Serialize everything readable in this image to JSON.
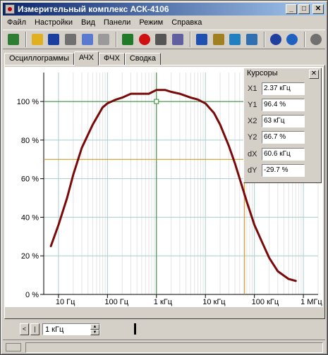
{
  "window": {
    "title": "Измерительный комплекс АСК-4106",
    "minimize_label": "_",
    "maximize_label": "□",
    "close_label": "✕"
  },
  "menu": [
    "Файл",
    "Настройки",
    "Вид",
    "Панели",
    "Режим",
    "Справка"
  ],
  "toolbar": {
    "icons": [
      "exit-icon",
      "open-folder-icon",
      "save-icon",
      "camera-icon",
      "copy-icon",
      "print-icon",
      "run-icon",
      "stop-icon",
      "step-icon",
      "scale-icon",
      "info-panel-icon",
      "cursor-tool-icon",
      "generator-icon",
      "filter-icon",
      "help-icon",
      "info-icon",
      "refresh-icon"
    ],
    "colors": {
      "exit-icon": "#2e7d32",
      "open-folder-icon": "#e0b020",
      "save-icon": "#1a3fa0",
      "camera-icon": "#707070",
      "copy-icon": "#5a7ad0",
      "print-icon": "#9a9a9a",
      "run-icon": "#1f7a2a",
      "stop-icon": "#d01010",
      "step-icon": "#555555",
      "scale-icon": "#6060a0",
      "info-panel-icon": "#2050b0",
      "cursor-tool-icon": "#a08020",
      "generator-icon": "#2080c0",
      "filter-icon": "#3070b0",
      "help-icon": "#2040a0",
      "info-icon": "#2060c0",
      "refresh-icon": "#707070"
    }
  },
  "tabs": [
    {
      "label": "Осциллограммы",
      "active": false
    },
    {
      "label": "АЧХ",
      "active": true
    },
    {
      "label": "ФЧХ",
      "active": false
    },
    {
      "label": "Сводка",
      "active": false
    }
  ],
  "cursors": {
    "title": "Курсоры",
    "close_label": "✕",
    "rows": [
      {
        "label": "X1",
        "value": "2.37 кГц"
      },
      {
        "label": "Y1",
        "value": "96.4 %"
      },
      {
        "label": "X2",
        "value": "63 кГц"
      },
      {
        "label": "Y2",
        "value": "66.7 %"
      },
      {
        "label": "dX",
        "value": "60.6 кГц"
      },
      {
        "label": "dY",
        "value": "-29.7 %"
      }
    ]
  },
  "bottom": {
    "prev_label": "<",
    "next_label": "|",
    "step_value": "1 кГц"
  },
  "chart_data": {
    "type": "line",
    "title": "",
    "xlabel": "",
    "ylabel": "",
    "x_scale": "log",
    "xlim": [
      5,
      2000000
    ],
    "ylim": [
      0,
      115
    ],
    "x_ticks": [
      {
        "value": 10,
        "label": "10 Гц"
      },
      {
        "value": 100,
        "label": "100 Гц"
      },
      {
        "value": 1000,
        "label": "1 кГц"
      },
      {
        "value": 10000,
        "label": "10 кГц"
      },
      {
        "value": 100000,
        "label": "100 кГц"
      },
      {
        "value": 1000000,
        "label": "1 МГц"
      }
    ],
    "y_ticks": [
      {
        "value": 0,
        "label": "0 %"
      },
      {
        "value": 20,
        "label": "20 %"
      },
      {
        "value": 40,
        "label": "40 %"
      },
      {
        "value": 60,
        "label": "60 %"
      },
      {
        "value": 80,
        "label": "80 %"
      },
      {
        "value": 100,
        "label": "100 %"
      }
    ],
    "grid": true,
    "series": [
      {
        "color": "#7a0a0a",
        "x": [
          7,
          10,
          15,
          20,
          30,
          50,
          80,
          100,
          150,
          200,
          300,
          500,
          700,
          1000,
          1500,
          2000,
          3000,
          5000,
          7000,
          10000,
          15000,
          20000,
          30000,
          40000,
          50000,
          70000,
          100000,
          150000,
          200000,
          300000,
          500000,
          700000
        ],
        "y": [
          25,
          36,
          50,
          62,
          76,
          88,
          97,
          99,
          101,
          102,
          104,
          104,
          104,
          106,
          106,
          105,
          104,
          102,
          101,
          99,
          94,
          88,
          77,
          68,
          60,
          48,
          36,
          26,
          19,
          12,
          8,
          7
        ]
      }
    ],
    "cursors": [
      {
        "name": "cursor-1",
        "color": "#2e8b2e",
        "x": 1000,
        "y": 100
      },
      {
        "name": "cursor-2",
        "color": "#c89010",
        "x": 63000,
        "y": 70
      }
    ]
  }
}
